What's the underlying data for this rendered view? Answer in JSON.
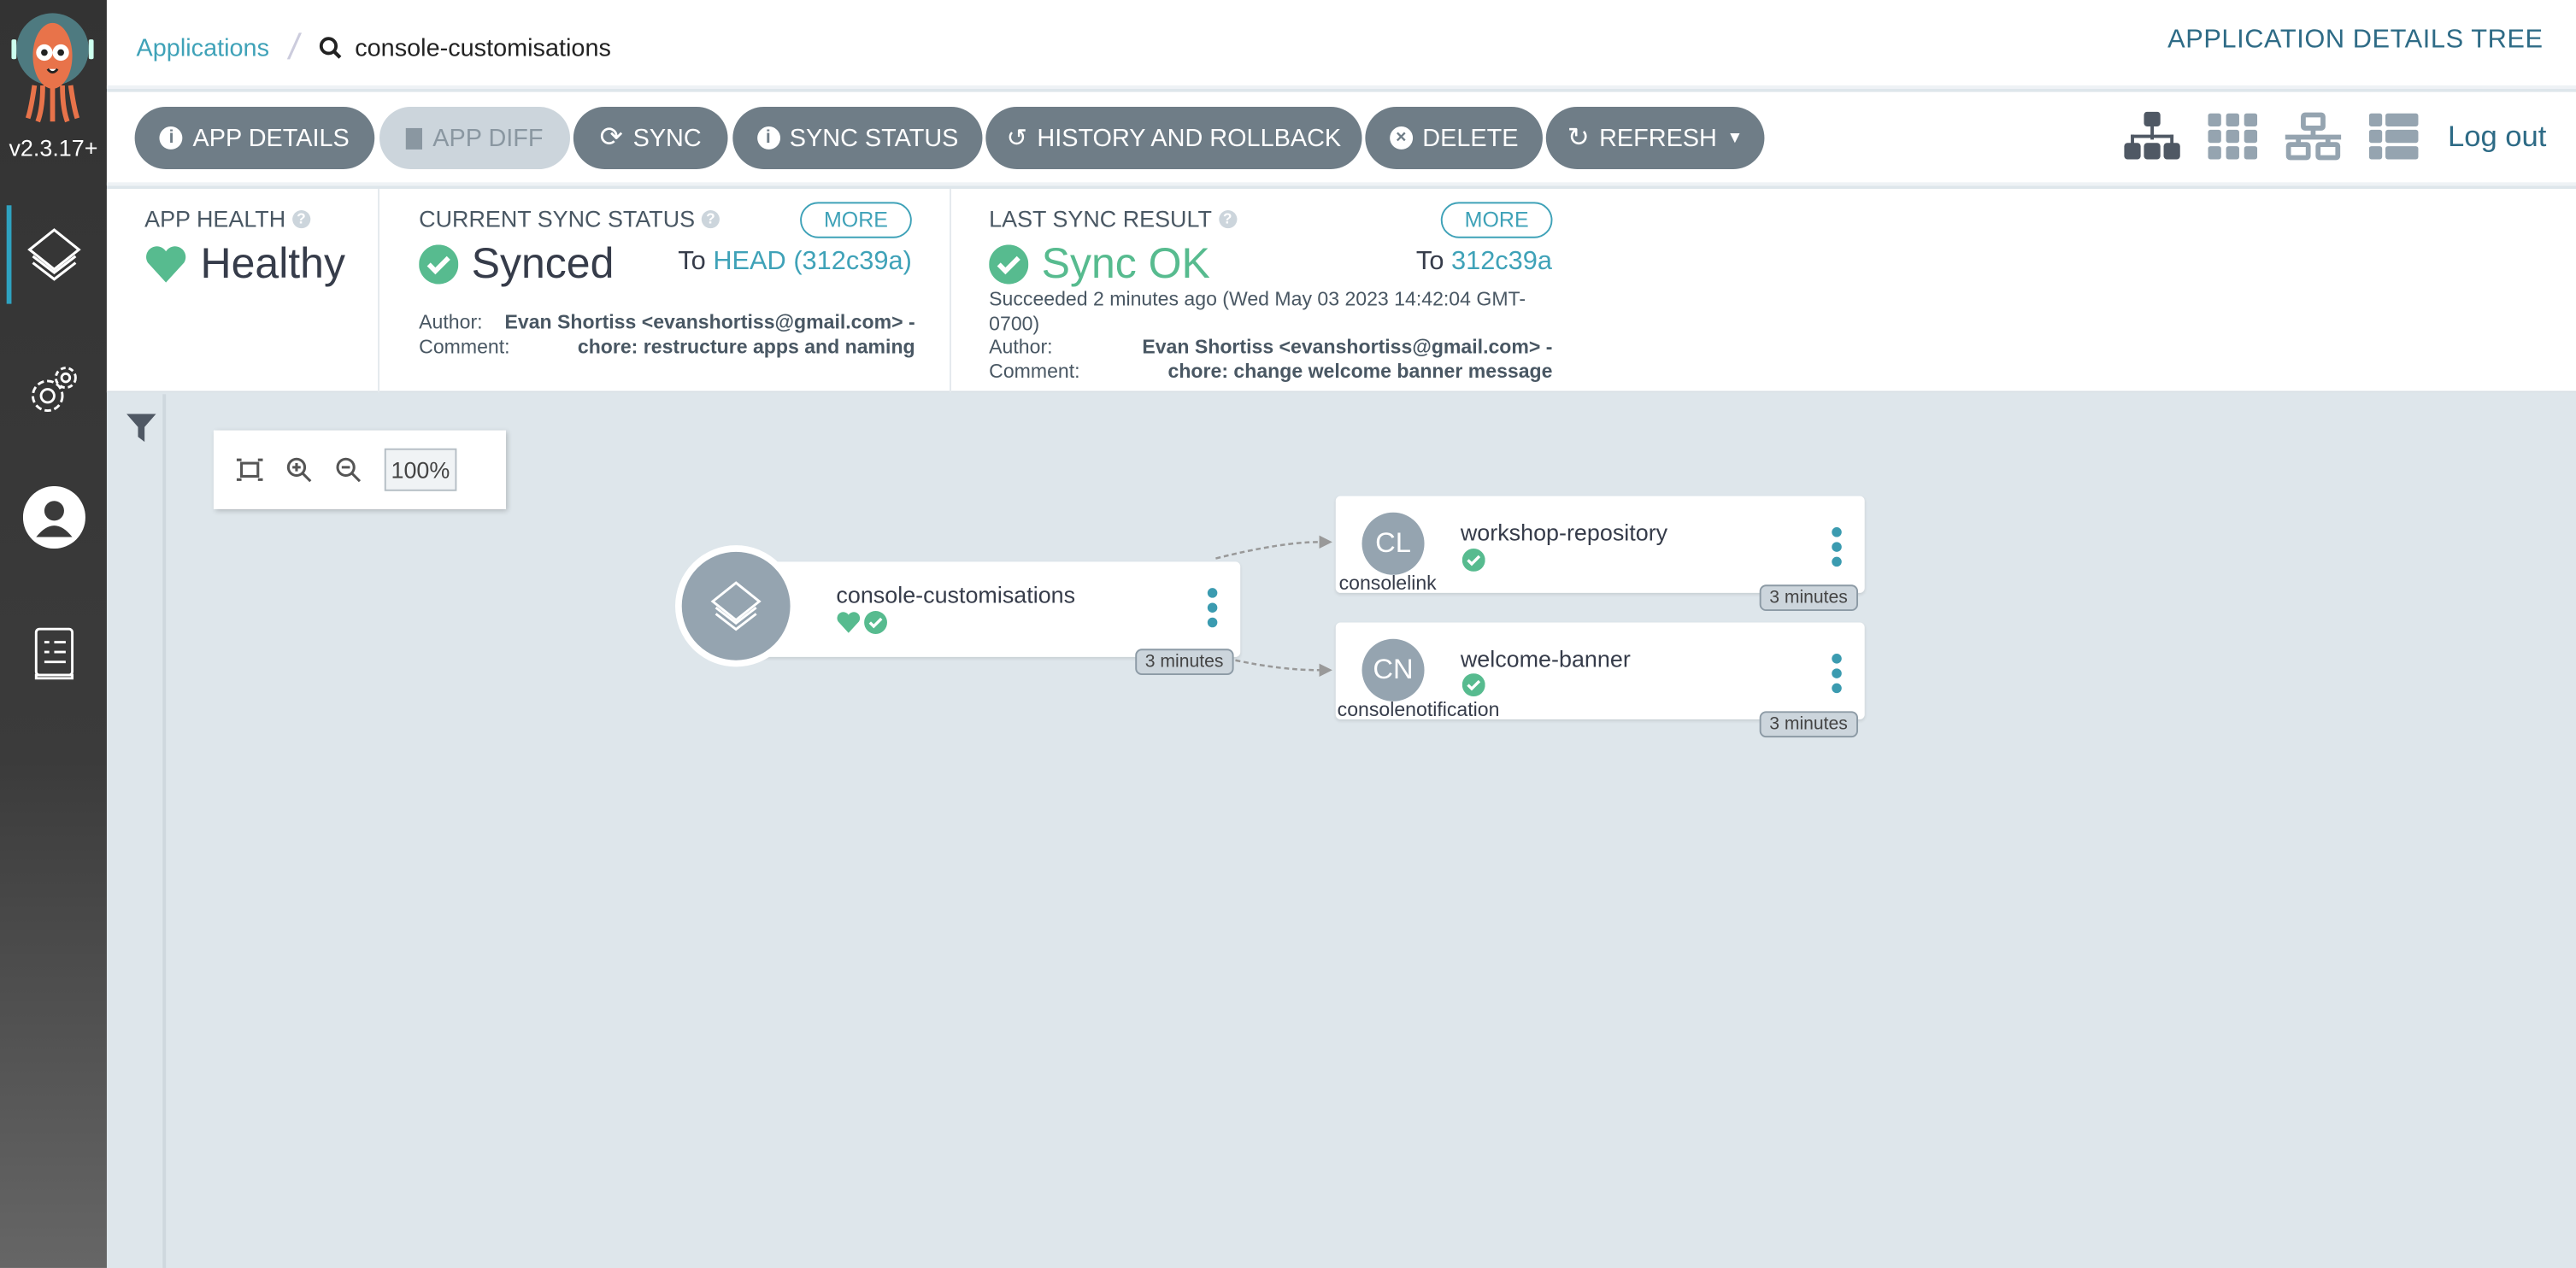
{
  "sidebar": {
    "version": "v2.3.17+",
    "items": [
      {
        "id": "applications",
        "icon": "layers-icon",
        "active": true
      },
      {
        "id": "settings",
        "icon": "gear-icon"
      },
      {
        "id": "user-info",
        "icon": "user-icon"
      },
      {
        "id": "documentation",
        "icon": "docs-icon"
      }
    ]
  },
  "header": {
    "breadcrumb_root": "Applications",
    "breadcrumb_current": "console-customisations",
    "page_title": "APPLICATION DETAILS TREE"
  },
  "toolbar": {
    "buttons": [
      "APP DETAILS",
      "APP DIFF",
      "SYNC",
      "SYNC STATUS",
      "HISTORY AND ROLLBACK",
      "DELETE",
      "REFRESH"
    ],
    "logout": "Log out",
    "views": [
      "tree",
      "pods",
      "network",
      "list"
    ],
    "active_view": "tree"
  },
  "status": {
    "health": {
      "label": "APP HEALTH",
      "value": "Healthy"
    },
    "sync": {
      "label": "CURRENT SYNC STATUS",
      "more": "MORE",
      "value": "Synced",
      "to_prefix": "To",
      "revision": "HEAD (312c39a)",
      "author_label": "Author:",
      "author": "Evan Shortiss <evanshortiss@gmail.com> -",
      "comment_label": "Comment:",
      "comment": "chore: restructure apps and naming"
    },
    "last": {
      "label": "LAST SYNC RESULT",
      "more": "MORE",
      "value": "Sync OK",
      "to_prefix": "To",
      "revision": "312c39a",
      "succeeded_1": "Succeeded 2 minutes ago (Wed May 03 2023 14:42:04 GMT-",
      "succeeded_2": "0700)",
      "author_label": "Author:",
      "author": "Evan Shortiss <evanshortiss@gmail.com> -",
      "comment_label": "Comment:",
      "comment": "chore: change welcome banner message"
    }
  },
  "colors": {
    "accent": "#3fa2b8",
    "healthy": "#57bb8f",
    "button": "#6f7d87",
    "title": "#2e6b86"
  },
  "graph": {
    "zoom": "100%",
    "app": {
      "name": "console-customisations",
      "age": "3 minutes"
    },
    "resources": [
      {
        "abbr": "CL",
        "name": "workshop-repository",
        "kind": "consolelink",
        "age": "3 minutes"
      },
      {
        "abbr": "CN",
        "name": "welcome-banner",
        "kind": "consolenotification",
        "age": "3 minutes"
      }
    ]
  }
}
